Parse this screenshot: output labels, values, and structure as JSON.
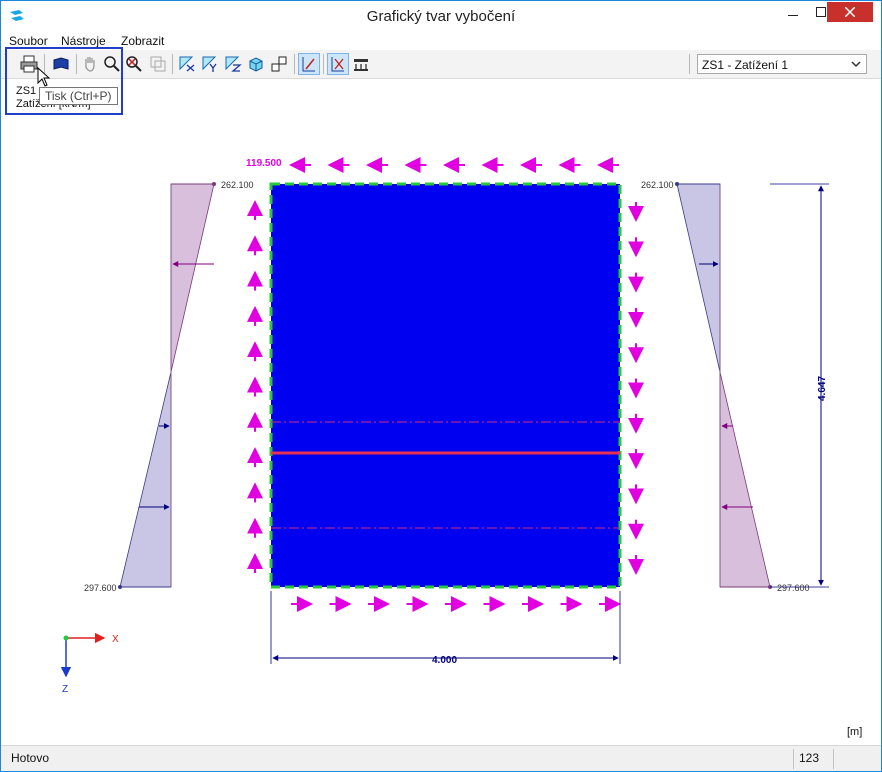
{
  "window": {
    "title": "Grafický tvar vybočení"
  },
  "menu": {
    "items": [
      "Soubor",
      "Nástroje",
      "Zobrazit"
    ]
  },
  "toolbar": {
    "load_case_select": "ZS1 - Zatížení 1"
  },
  "tooltip": {
    "text": "Tisk (Ctrl+P)"
  },
  "canvas": {
    "info_line1": "ZS1",
    "info_line2": "Zatížení [kN/m]",
    "top_load_value": "119.500",
    "left_top_value": "262.100",
    "left_bottom_value": "297.600",
    "right_top_value": "262.100",
    "right_bottom_value": "297.600",
    "height_dimension": "4.647",
    "width_dimension": "4.000",
    "axis_x": "X",
    "axis_z": "Z",
    "unit": "[m]"
  },
  "statusbar": {
    "text": "Hotovo",
    "number": "123"
  },
  "colors": {
    "plate": "#0000f0",
    "load": "#e000e0",
    "support": "#27c83e",
    "dimension": "#000080",
    "buckling_line": "#e83050",
    "diagram_left_top": "#d8bfdc",
    "diagram_bottom": "#c8c6e4",
    "highlight": "#1f3fc8"
  }
}
